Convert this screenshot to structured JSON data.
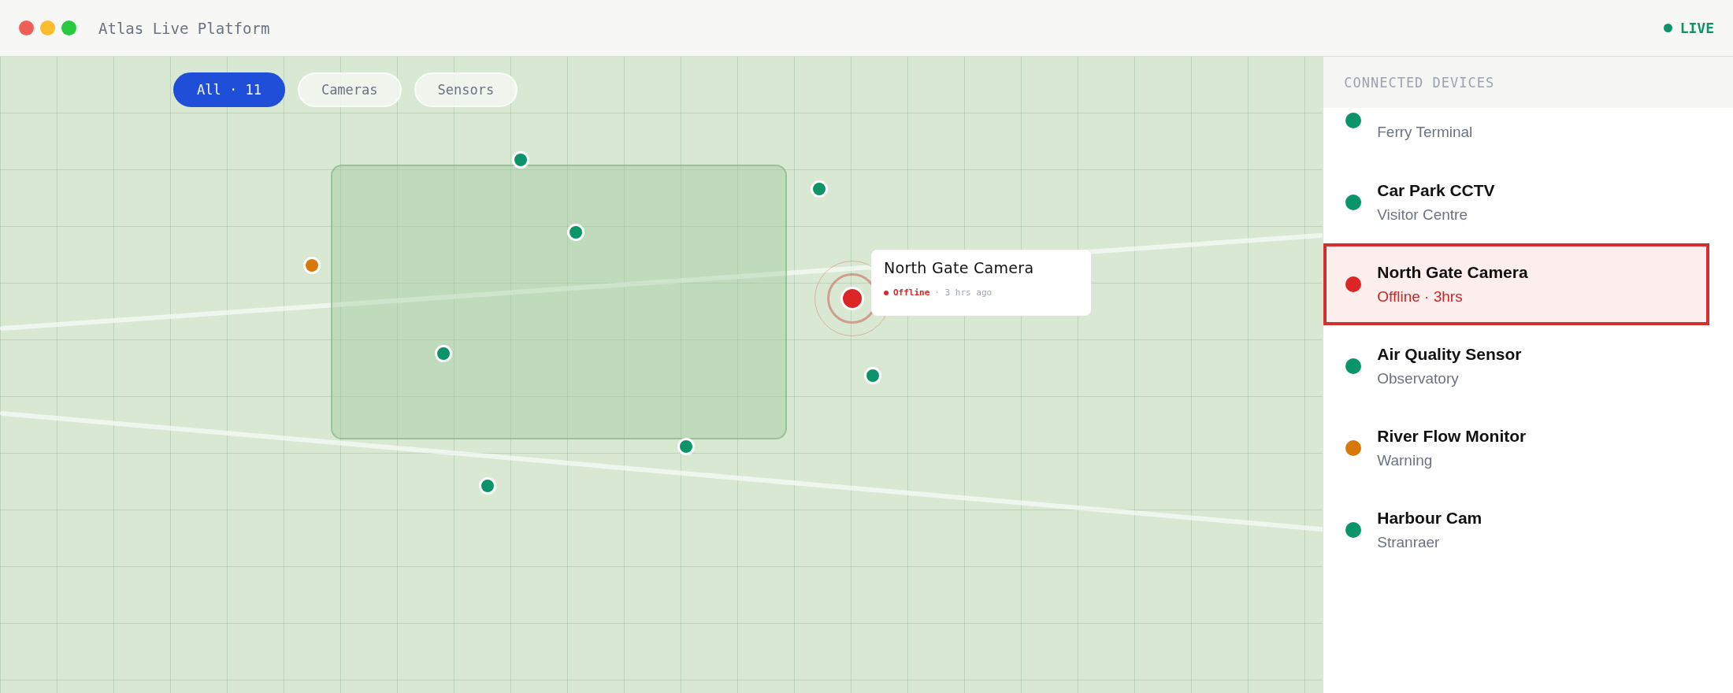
{
  "window": {
    "title": "Atlas Live Platform",
    "live": "LIVE"
  },
  "filters": [
    {
      "label": "All · 11",
      "selected": true
    },
    {
      "label": "Cameras",
      "selected": false
    },
    {
      "label": "Sensors",
      "selected": false
    }
  ],
  "map": {
    "pins": [
      {
        "color": "#0a9467",
        "selected": false
      },
      {
        "color": "#0a9467",
        "selected": false
      },
      {
        "color": "#0a9467",
        "selected": false
      },
      {
        "color": "#d9780a",
        "selected": false
      },
      {
        "color": "#dc2626",
        "selected": true
      },
      {
        "color": "#0a9467",
        "selected": false
      },
      {
        "color": "#0a9467",
        "selected": false
      },
      {
        "color": "#0a9467",
        "selected": false
      },
      {
        "color": "#0a9467",
        "selected": false
      }
    ],
    "popup": {
      "title": "North Gate Camera",
      "status": "Offline",
      "time": "· 3 hrs ago"
    }
  },
  "sidebar": {
    "title": "CONNECTED DEVICES",
    "devices": [
      {
        "location": "Ferry Terminal",
        "color": "#0a9467",
        "selected": false
      },
      {
        "name": "Car Park CCTV",
        "location": "Visitor Centre",
        "color": "#0a9467",
        "selected": false
      },
      {
        "name": "North Gate Camera",
        "location": "Offline · 3hrs",
        "color": "#dc2626",
        "selected": true
      },
      {
        "name": "Air Quality Sensor",
        "location": "Observatory",
        "color": "#0a9467",
        "selected": false
      },
      {
        "name": "River Flow Monitor",
        "location": "Warning",
        "color": "#d9780a",
        "selected": false
      },
      {
        "name": "Harbour Cam",
        "location": "Stranraer",
        "color": "#0a9467",
        "selected": false
      }
    ]
  }
}
